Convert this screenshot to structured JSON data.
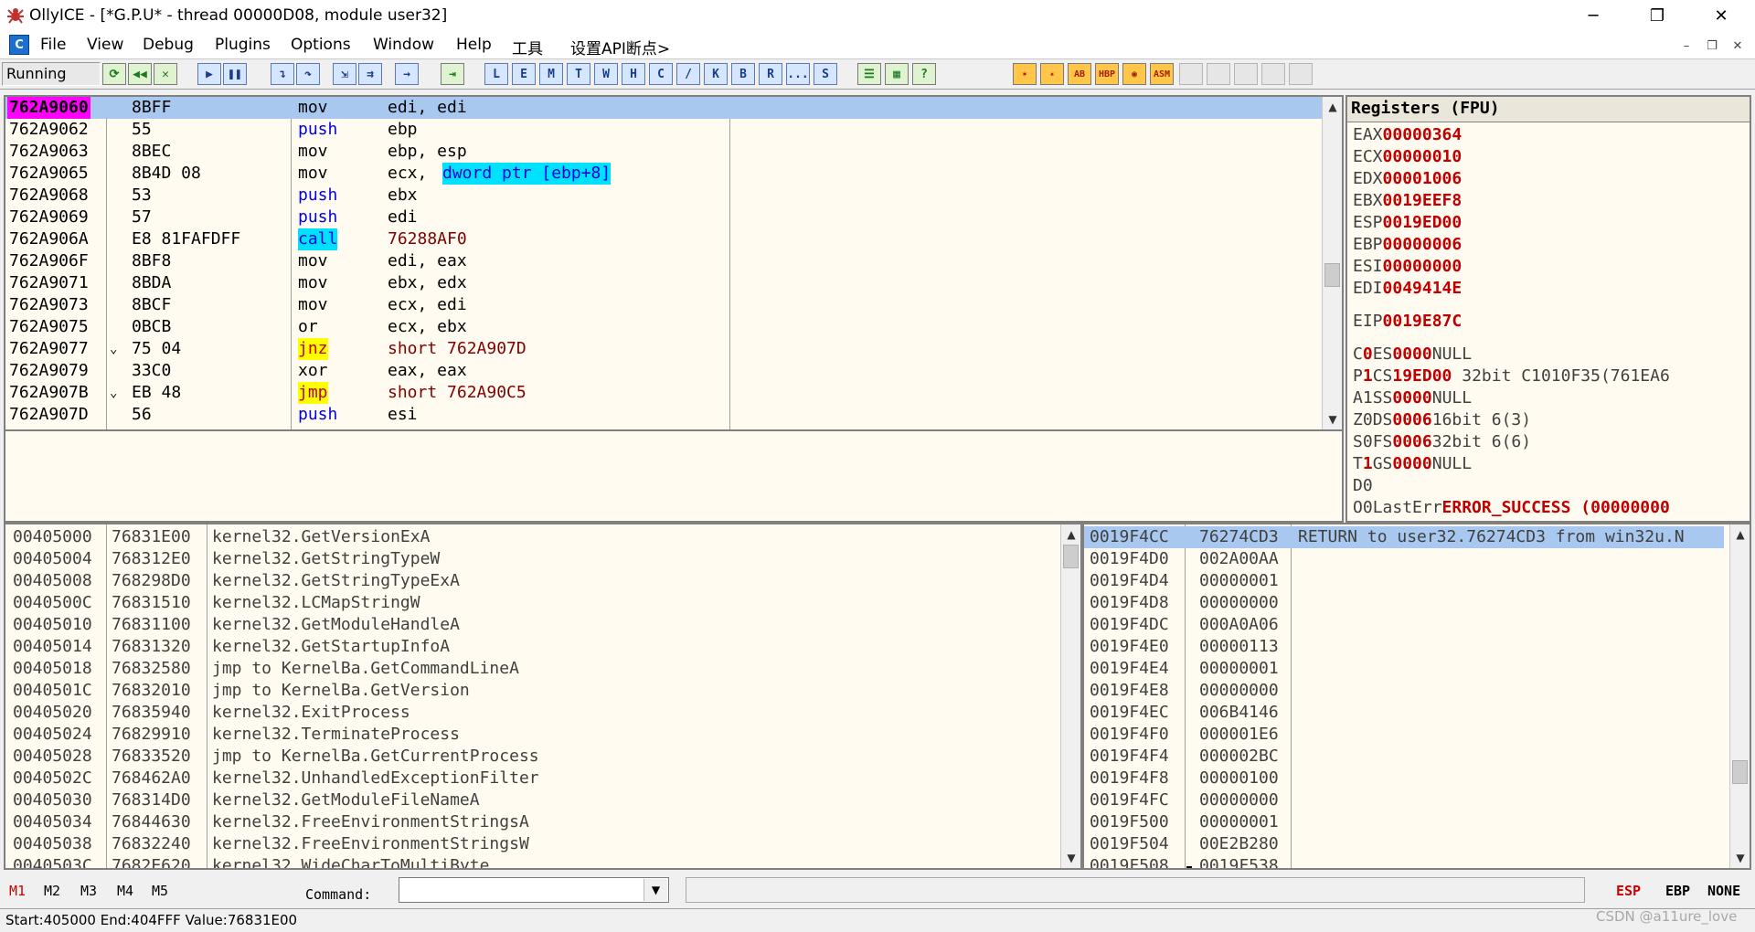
{
  "window": {
    "title": "OllyICE - [*G.P.U* - thread 00000D08, module user32]",
    "minimize": "─",
    "maximize": "❐",
    "close": "✕"
  },
  "menu": {
    "icon_label": "C",
    "items": [
      "File",
      "View",
      "Debug",
      "Plugins",
      "Options",
      "Window",
      "Help",
      "工具",
      "设置API断点>"
    ],
    "mdi_min": "–",
    "mdi_restore": "❐",
    "mdi_close": "✕"
  },
  "toolbar": {
    "status": "Running",
    "window_letters": [
      "L",
      "E",
      "M",
      "T",
      "W",
      "H",
      "C",
      "/",
      "K",
      "B",
      "R",
      "...",
      "S"
    ],
    "right_labels": [
      "HBP",
      "ASM"
    ]
  },
  "disasm": {
    "rows": [
      {
        "addr": "762A9060",
        "hex": "8BFF",
        "mn": "mov",
        "ops": "edi, edi",
        "mark": "",
        "sel": true
      },
      {
        "addr": "762A9062",
        "hex": "55",
        "mn": "push",
        "ops": "ebp",
        "mark": ""
      },
      {
        "addr": "762A9063",
        "hex": "8BEC",
        "mn": "mov",
        "ops": "ebp, esp",
        "mark": ""
      },
      {
        "addr": "762A9065",
        "hex": "8B4D 08",
        "mn": "mov",
        "ops_a": "ecx, ",
        "ops_b": "dword ptr [ebp+8]",
        "mark": ""
      },
      {
        "addr": "762A9068",
        "hex": "53",
        "mn": "push",
        "ops": "ebx",
        "mark": ""
      },
      {
        "addr": "762A9069",
        "hex": "57",
        "mn": "push",
        "ops": "edi",
        "mark": ""
      },
      {
        "addr": "762A906A",
        "hex": "E8 81FAFDFF",
        "mn": "call",
        "ops": "76288AF0",
        "mark": ""
      },
      {
        "addr": "762A906F",
        "hex": "8BF8",
        "mn": "mov",
        "ops": "edi, eax",
        "mark": ""
      },
      {
        "addr": "762A9071",
        "hex": "8BDA",
        "mn": "mov",
        "ops": "ebx, edx",
        "mark": ""
      },
      {
        "addr": "762A9073",
        "hex": "8BCF",
        "mn": "mov",
        "ops": "ecx, edi",
        "mark": ""
      },
      {
        "addr": "762A9075",
        "hex": "0BCB",
        "mn": "or",
        "ops": "ecx, ebx",
        "mark": ""
      },
      {
        "addr": "762A9077",
        "hex": "75 04",
        "mn": "jnz",
        "ops": "short 762A907D",
        "mark": "⌄"
      },
      {
        "addr": "762A9079",
        "hex": "33C0",
        "mn": "xor",
        "ops": "eax, eax",
        "mark": ""
      },
      {
        "addr": "762A907B",
        "hex": "EB 48",
        "mn": "jmp",
        "ops": "short 762A90C5",
        "mark": "⌄"
      },
      {
        "addr": "762A907D",
        "hex": "56",
        "mn": "push",
        "ops": "esi",
        "mark": ""
      }
    ]
  },
  "registers": {
    "header": "Registers (FPU)",
    "gp": [
      {
        "name": "EAX",
        "val": "00000364"
      },
      {
        "name": "ECX",
        "val": "00000010"
      },
      {
        "name": "EDX",
        "val": "00001006"
      },
      {
        "name": "EBX",
        "val": "0019EEF8"
      },
      {
        "name": "ESP",
        "val": "0019ED00"
      },
      {
        "name": "EBP",
        "val": "00000006"
      },
      {
        "name": "ESI",
        "val": "00000000"
      },
      {
        "name": "EDI",
        "val": "0049414E"
      }
    ],
    "eip": {
      "name": "EIP",
      "val": "0019E87C"
    },
    "flags": [
      {
        "f": "C",
        "v": "0",
        "vred": true,
        "seg": "ES",
        "sv": "0000",
        "desc": "NULL"
      },
      {
        "f": "P",
        "v": "1",
        "vred": true,
        "seg": "CS",
        "sv": "19ED00",
        "desc": " 32bit C1010F35(761EA6"
      },
      {
        "f": "A",
        "v": "1",
        "vred": false,
        "seg": "SS",
        "sv": "0000",
        "desc": "NULL"
      },
      {
        "f": "Z",
        "v": "0",
        "vred": false,
        "seg": "DS",
        "sv": "0006",
        "desc": "16bit 6(3)"
      },
      {
        "f": "S",
        "v": "0",
        "vred": false,
        "seg": "FS",
        "sv": "0006",
        "desc": "32bit 6(6)"
      },
      {
        "f": "T",
        "v": "1",
        "vred": true,
        "seg": "GS",
        "sv": "0000",
        "desc": "NULL"
      },
      {
        "f": "D",
        "v": "0",
        "vred": false,
        "seg": "",
        "sv": "",
        "desc": ""
      }
    ],
    "lasterr": {
      "f": "O",
      "v": "0",
      "label": "LastErr",
      "val": "ERROR_SUCCESS (00000000"
    }
  },
  "dump": {
    "rows": [
      {
        "addr": "00405000",
        "val": "76831E00",
        "text": "kernel32.GetVersionExA"
      },
      {
        "addr": "00405004",
        "val": "768312E0",
        "text": "kernel32.GetStringTypeW"
      },
      {
        "addr": "00405008",
        "val": "768298D0",
        "text": "kernel32.GetStringTypeExA"
      },
      {
        "addr": "0040500C",
        "val": "76831510",
        "text": "kernel32.LCMapStringW"
      },
      {
        "addr": "00405010",
        "val": "76831100",
        "text": "kernel32.GetModuleHandleA"
      },
      {
        "addr": "00405014",
        "val": "76831320",
        "text": "kernel32.GetStartupInfoA"
      },
      {
        "addr": "00405018",
        "val": "76832580",
        "text": "jmp to KernelBa.GetCommandLineA"
      },
      {
        "addr": "0040501C",
        "val": "76832010",
        "text": "jmp to KernelBa.GetVersion"
      },
      {
        "addr": "00405020",
        "val": "76835940",
        "text": "kernel32.ExitProcess"
      },
      {
        "addr": "00405024",
        "val": "76829910",
        "text": "kernel32.TerminateProcess"
      },
      {
        "addr": "00405028",
        "val": "76833520",
        "text": "jmp to KernelBa.GetCurrentProcess"
      },
      {
        "addr": "0040502C",
        "val": "768462A0",
        "text": "kernel32.UnhandledExceptionFilter"
      },
      {
        "addr": "00405030",
        "val": "768314D0",
        "text": "kernel32.GetModuleFileNameA"
      },
      {
        "addr": "00405034",
        "val": "76844630",
        "text": "kernel32.FreeEnvironmentStringsA"
      },
      {
        "addr": "00405038",
        "val": "76832240",
        "text": "kernel32.FreeEnvironmentStringsW"
      },
      {
        "addr": "0040503C",
        "val": "7682E620",
        "text": "kernel32.WideCharToMultiByte"
      }
    ]
  },
  "stack": {
    "rows": [
      {
        "addr": "0019F4CC",
        "val": "76274CD3",
        "cmt": "RETURN to user32.76274CD3 from win32u.N",
        "sel": true
      },
      {
        "addr": "0019F4D0",
        "val": "002A00AA",
        "cmt": ""
      },
      {
        "addr": "0019F4D4",
        "val": "00000001",
        "cmt": ""
      },
      {
        "addr": "0019F4D8",
        "val": "00000000",
        "cmt": ""
      },
      {
        "addr": "0019F4DC",
        "val": "000A0A06",
        "cmt": ""
      },
      {
        "addr": "0019F4E0",
        "val": "00000113",
        "cmt": ""
      },
      {
        "addr": "0019F4E4",
        "val": "00000001",
        "cmt": ""
      },
      {
        "addr": "0019F4E8",
        "val": "00000000",
        "cmt": ""
      },
      {
        "addr": "0019F4EC",
        "val": "006B4146",
        "cmt": ""
      },
      {
        "addr": "0019F4F0",
        "val": "000001E6",
        "cmt": ""
      },
      {
        "addr": "0019F4F4",
        "val": "000002BC",
        "cmt": ""
      },
      {
        "addr": "0019F4F8",
        "val": "00000100",
        "cmt": ""
      },
      {
        "addr": "0019F4FC",
        "val": "00000000",
        "cmt": ""
      },
      {
        "addr": "0019F500",
        "val": "00000001",
        "cmt": ""
      },
      {
        "addr": "0019F504",
        "val": "00E2B280",
        "cmt": ""
      },
      {
        "addr": "0019F508",
        "val": "0019F538",
        "cmt": "",
        "frame": true
      }
    ]
  },
  "bottom": {
    "marks": [
      "M1",
      "M2",
      "M3",
      "M4",
      "M5"
    ],
    "command_label": "Command:",
    "command_value": "",
    "reg_buttons": [
      "ESP",
      "EBP",
      "NONE"
    ]
  },
  "statusbar": {
    "text": "Start:405000 End:404FFF Value:76831E00",
    "watermark": "CSDN @a11ure_love"
  },
  "colors": {
    "pane_bg": "#fffbf0",
    "selection": "#a8c8f0",
    "eip_bg": "#ff00ff",
    "register_value": "#c00000",
    "push_call": "#0000e0",
    "jump_bg": "#ffff00",
    "call_bg": "#00e0ff",
    "jump_text": "#c00000",
    "branch_target": "#800000"
  }
}
